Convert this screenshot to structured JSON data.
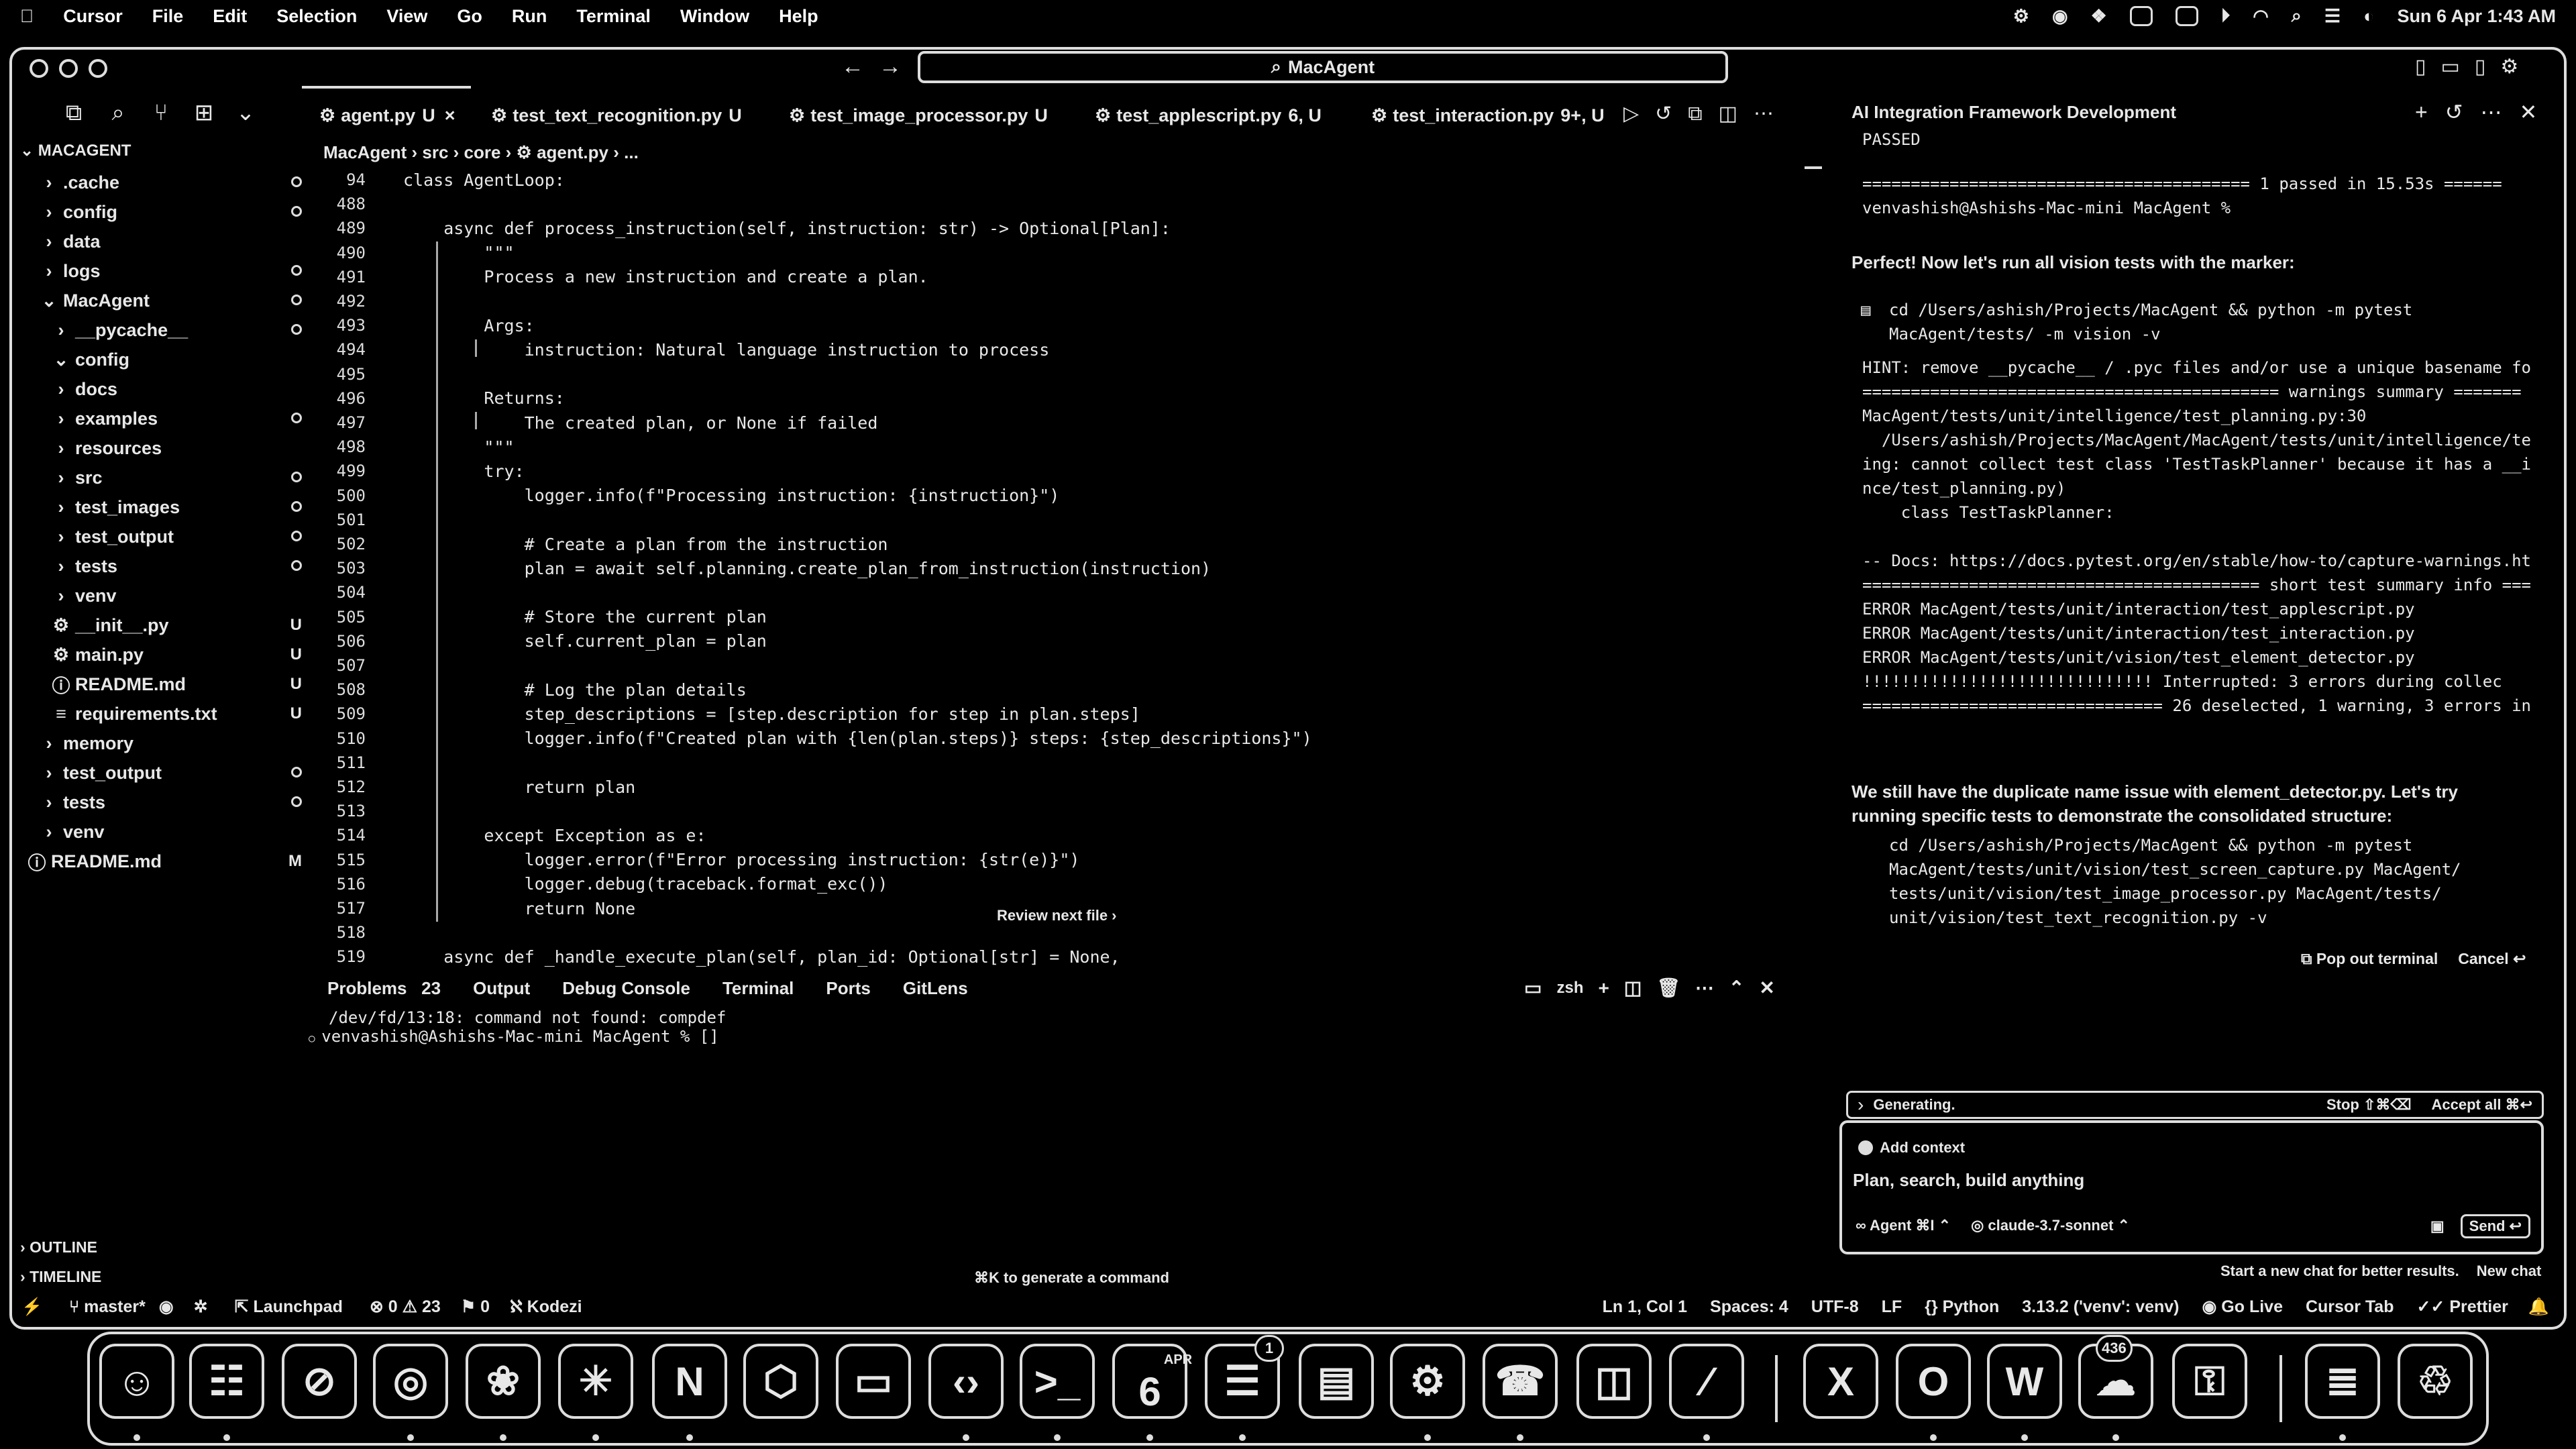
{
  "menubar": {
    "apple": "",
    "items": [
      "Cursor",
      "File",
      "Edit",
      "Selection",
      "View",
      "Go",
      "Run",
      "Terminal",
      "Window",
      "Help"
    ],
    "datetime": "Sun 6 Apr  1:43 AM"
  },
  "window": {
    "command_center": "MacAgent"
  },
  "sidebar": {
    "root": "MACAGENT",
    "items": [
      {
        "label": ".cache",
        "indent": 1,
        "chev": "›",
        "status": "dot"
      },
      {
        "label": "config",
        "indent": 1,
        "chev": "›",
        "status": "dot"
      },
      {
        "label": "data",
        "indent": 1,
        "chev": "›",
        "status": ""
      },
      {
        "label": "logs",
        "indent": 1,
        "chev": "›",
        "status": "dot"
      },
      {
        "label": "MacAgent",
        "indent": 1,
        "chev": "⌄",
        "status": "dot"
      },
      {
        "label": "__pycache__",
        "indent": 2,
        "chev": "›",
        "status": "dot"
      },
      {
        "label": "config",
        "indent": 2,
        "chev": "⌄",
        "status": ""
      },
      {
        "label": "docs",
        "indent": 2,
        "chev": "›",
        "status": ""
      },
      {
        "label": "examples",
        "indent": 2,
        "chev": "›",
        "status": "dot"
      },
      {
        "label": "resources",
        "indent": 2,
        "chev": "›",
        "status": ""
      },
      {
        "label": "src",
        "indent": 2,
        "chev": "›",
        "status": "dot"
      },
      {
        "label": "test_images",
        "indent": 2,
        "chev": "›",
        "status": "dot"
      },
      {
        "label": "test_output",
        "indent": 2,
        "chev": "›",
        "status": "dot"
      },
      {
        "label": "tests",
        "indent": 2,
        "chev": "›",
        "status": "dot"
      },
      {
        "label": "venv",
        "indent": 2,
        "chev": "›",
        "status": ""
      },
      {
        "label": "__init__.py",
        "indent": 2,
        "chev": "⚙",
        "status": "U"
      },
      {
        "label": "main.py",
        "indent": 2,
        "chev": "⚙",
        "status": "U"
      },
      {
        "label": "README.md",
        "indent": 2,
        "chev": "ⓘ",
        "status": "U"
      },
      {
        "label": "requirements.txt",
        "indent": 2,
        "chev": "≡",
        "status": "U"
      },
      {
        "label": "memory",
        "indent": 1,
        "chev": "›",
        "status": ""
      },
      {
        "label": "test_output",
        "indent": 1,
        "chev": "›",
        "status": "dot"
      },
      {
        "label": "tests",
        "indent": 1,
        "chev": "›",
        "status": "dot"
      },
      {
        "label": "venv",
        "indent": 1,
        "chev": "›",
        "status": ""
      },
      {
        "label": "README.md",
        "indent": 0,
        "chev": "ⓘ",
        "status": "M"
      }
    ],
    "outline": "OUTLINE",
    "timeline": "TIMELINE"
  },
  "tabs": [
    {
      "label": "agent.py",
      "status": "U",
      "close": "×"
    },
    {
      "label": "test_text_recognition.py",
      "status": "U"
    },
    {
      "label": "test_image_processor.py",
      "status": "U"
    },
    {
      "label": "test_applescript.py",
      "status": "6, U"
    },
    {
      "label": "test_interaction.py",
      "status": "9+, U"
    }
  ],
  "breadcrumb": [
    "MacAgent",
    "src",
    "core",
    "agent.py",
    "..."
  ],
  "code": [
    {
      "n": "94",
      "t": "class AgentLoop:"
    },
    {
      "n": "488",
      "t": ""
    },
    {
      "n": "489",
      "t": "    async def process_instruction(self, instruction: str) -> Optional[Plan]:"
    },
    {
      "n": "490",
      "t": "        \"\"\""
    },
    {
      "n": "491",
      "t": "        Process a new instruction and create a plan."
    },
    {
      "n": "492",
      "t": ""
    },
    {
      "n": "493",
      "t": "        Args:"
    },
    {
      "n": "494",
      "t": "            instruction: Natural language instruction to process"
    },
    {
      "n": "495",
      "t": ""
    },
    {
      "n": "496",
      "t": "        Returns:"
    },
    {
      "n": "497",
      "t": "            The created plan, or None if failed"
    },
    {
      "n": "498",
      "t": "        \"\"\""
    },
    {
      "n": "499",
      "t": "        try:"
    },
    {
      "n": "500",
      "t": "            logger.info(f\"Processing instruction: {instruction}\")"
    },
    {
      "n": "501",
      "t": ""
    },
    {
      "n": "502",
      "t": "            # Create a plan from the instruction"
    },
    {
      "n": "503",
      "t": "            plan = await self.planning.create_plan_from_instruction(instruction)"
    },
    {
      "n": "504",
      "t": ""
    },
    {
      "n": "505",
      "t": "            # Store the current plan"
    },
    {
      "n": "506",
      "t": "            self.current_plan = plan"
    },
    {
      "n": "507",
      "t": ""
    },
    {
      "n": "508",
      "t": "            # Log the plan details"
    },
    {
      "n": "509",
      "t": "            step_descriptions = [step.description for step in plan.steps]"
    },
    {
      "n": "510",
      "t": "            logger.info(f\"Created plan with {len(plan.steps)} steps: {step_descriptions}\")"
    },
    {
      "n": "511",
      "t": ""
    },
    {
      "n": "512",
      "t": "            return plan"
    },
    {
      "n": "513",
      "t": ""
    },
    {
      "n": "514",
      "t": "        except Exception as e:"
    },
    {
      "n": "515",
      "t": "            logger.error(f\"Error processing instruction: {str(e)}\")"
    },
    {
      "n": "516",
      "t": "            logger.debug(traceback.format_exc())"
    },
    {
      "n": "517",
      "t": "            return None"
    },
    {
      "n": "518",
      "t": ""
    },
    {
      "n": "519",
      "t": "    async def _handle_execute_plan(self, plan_id: Optional[str] = None,"
    }
  ],
  "review_next": "Review next file ›",
  "panel": {
    "tabs": [
      "Problems",
      "Output",
      "Debug Console",
      "Terminal",
      "Ports",
      "GitLens"
    ],
    "problems_count": "23",
    "shell": "zsh",
    "lines": [
      "/dev/fd/13:18: command not found: compdef",
      "venvashish@Ashishs-Mac-mini MacAgent % []"
    ],
    "hint": "⌘K to generate a command"
  },
  "chat": {
    "title": "AI Integration Framework Development",
    "prompt": "Plan, search, build anything",
    "add_context": "Add context",
    "agent_label": "∞ Agent ⌘I",
    "model": "claude-3.7-sonnet",
    "send": "Send ↩",
    "generating": "Generating.",
    "stop": "Stop ⇧⌘⌫",
    "accept_all": "Accept all ⌘↩",
    "pop_out": "Pop out terminal",
    "cancel": "Cancel ↩",
    "footer_hint": "Start a new chat for better results.",
    "new_chat": "New chat",
    "lines": [
      "PASSED",
      "======================================== 1 passed in 15.53s ======",
      "venvashish@Ashishs-Mac-mini MacAgent %",
      "HINT: remove __pycache__ / .pyc files and/or use a unique basename fo",
      "=========================================== warnings summary =======",
      "MacAgent/tests/unit/intelligence/test_planning.py:30",
      "  /Users/ashish/Projects/MacAgent/MacAgent/tests/unit/intelligence/te",
      "ing: cannot collect test class 'TestTaskPlanner' because it has a __i",
      "nce/test_planning.py)",
      "    class TestTaskPlanner:",
      "-- Docs: https://docs.pytest.org/en/stable/how-to/capture-warnings.ht",
      "========================================= short test summary info ===",
      "ERROR MacAgent/tests/unit/interaction/test_applescript.py",
      "ERROR MacAgent/tests/unit/interaction/test_interaction.py",
      "ERROR MacAgent/tests/unit/vision/test_element_detector.py",
      "!!!!!!!!!!!!!!!!!!!!!!!!!!!!!! Interrupted: 3 errors during collec",
      "=============================== 26 deselected, 1 warning, 3 errors in"
    ],
    "prose1": "Perfect! Now let's run all vision tests with the marker:",
    "cmd1": [
      "cd /Users/ashish/Projects/MacAgent && python -m pytest",
      "MacAgent/tests/ -m vision -v"
    ],
    "prose2": "We still have the duplicate name issue with element_detector.py. Let's try running specific tests to demonstrate the consolidated structure:",
    "cmd2": [
      "cd /Users/ashish/Projects/MacAgent && python -m pytest",
      "MacAgent/tests/unit/vision/test_screen_capture.py MacAgent/",
      "tests/unit/vision/test_image_processor.py MacAgent/tests/",
      "unit/vision/test_text_recognition.py -v"
    ]
  },
  "statusbar": {
    "branch": "master*",
    "launchpad": "Launchpad",
    "errors": "0",
    "warnings": "23",
    "info": "0",
    "kodezi": "Kodezi",
    "position": "Ln 1, Col 1",
    "spaces": "Spaces: 4",
    "encoding": "UTF-8",
    "eol": "LF",
    "language": "Python",
    "interpreter": "3.13.2 ('venv': venv)",
    "golive": "Go Live",
    "cursor_tab": "Cursor Tab",
    "prettier": "Prettier"
  },
  "dock": {
    "apps": [
      {
        "name": "finder",
        "glyph": "☺"
      },
      {
        "name": "launchpad",
        "glyph": "☷"
      },
      {
        "name": "blocker",
        "glyph": "⊘"
      },
      {
        "name": "chrome",
        "glyph": "◎"
      },
      {
        "name": "chatgpt",
        "glyph": "❀"
      },
      {
        "name": "claude",
        "glyph": "✳"
      },
      {
        "name": "notion",
        "glyph": "N"
      },
      {
        "name": "box",
        "glyph": "⬡"
      },
      {
        "name": "blank",
        "glyph": "▭"
      },
      {
        "name": "vscode",
        "glyph": "‹›"
      },
      {
        "name": "terminal",
        "glyph": ">_"
      },
      {
        "name": "calendar",
        "glyph": "6"
      },
      {
        "name": "reminders",
        "glyph": "☰"
      },
      {
        "name": "wallet",
        "glyph": "▤"
      },
      {
        "name": "settings",
        "glyph": "⚙"
      },
      {
        "name": "whatsapp",
        "glyph": "☎"
      },
      {
        "name": "trello",
        "glyph": "◫"
      },
      {
        "name": "cursor-app",
        "glyph": "∕"
      },
      {
        "name": "excel",
        "glyph": "X"
      },
      {
        "name": "outlook",
        "glyph": "O"
      },
      {
        "name": "word",
        "glyph": "W"
      },
      {
        "name": "messages",
        "glyph": "☁"
      },
      {
        "name": "keychain",
        "glyph": "⚿"
      },
      {
        "name": "documents",
        "glyph": "≣"
      },
      {
        "name": "trash",
        "glyph": "♲"
      }
    ],
    "calendar_month": "APR",
    "reminders_badge": "1",
    "messages_badge": "436"
  }
}
